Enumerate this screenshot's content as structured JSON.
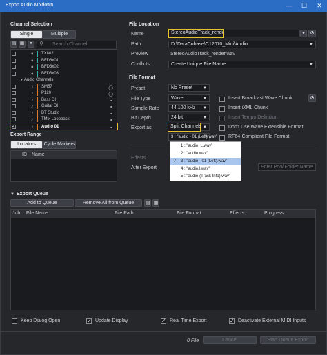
{
  "window": {
    "title": "Export Audio Mixdown",
    "minimize": "—",
    "maximize": "☐",
    "close": "✕"
  },
  "channel_selection": {
    "heading": "Channel Selection",
    "tabs": [
      {
        "label": "Single"
      },
      {
        "label": "Multiple"
      }
    ],
    "search_placeholder": "Search Channel",
    "tree_items": [
      {
        "name": "TX802",
        "color": "#2bb3a8",
        "checked": false,
        "type": "instrument"
      },
      {
        "name": "BFD3x01",
        "color": "#2bb3a8",
        "checked": false,
        "type": "instrument"
      },
      {
        "name": "BFD3x02",
        "color": "#2bb3a8",
        "checked": false,
        "type": "instrument"
      },
      {
        "name": "BFD3x03",
        "color": "#2bb3a8",
        "checked": false,
        "type": "instrument"
      },
      {
        "name": "Audio Channels",
        "color": "",
        "checked": false,
        "type": "group"
      },
      {
        "name": "SM57",
        "color": "#e07a2b",
        "checked": false,
        "type": "audio"
      },
      {
        "name": "P120",
        "color": "#e07a2b",
        "checked": false,
        "type": "audio"
      },
      {
        "name": "Bass DI",
        "color": "#e07a2b",
        "checked": false,
        "type": "audio"
      },
      {
        "name": "Guitar DI",
        "color": "#e07a2b",
        "checked": false,
        "type": "audio"
      },
      {
        "name": "BT Studio",
        "color": "#e07a2b",
        "checked": false,
        "type": "audio"
      },
      {
        "name": "TMix Loopback",
        "color": "#e07a2b",
        "checked": false,
        "type": "audio"
      },
      {
        "name": "Audio 01",
        "color": "#e07a2b",
        "checked": true,
        "type": "audio"
      }
    ]
  },
  "export_range": {
    "heading": "Export Range",
    "tabs": [
      {
        "label": "Locators"
      },
      {
        "label": "Cycle Markers"
      }
    ],
    "columns": [
      "ID",
      "Name"
    ]
  },
  "file_location": {
    "heading": "File Location",
    "name_label": "Name",
    "name_value": "StereoAudioTrack_render",
    "path_label": "Path",
    "path_value": "D:\\DataCubase\\C12070_Mini\\Audio",
    "preview_label": "Preview",
    "preview_value": "StereoAudioTrack_render.wav",
    "conflicts_label": "Conflicts",
    "conflicts_value": "Create Unique File Name"
  },
  "file_format": {
    "heading": "File Format",
    "preset_label": "Preset",
    "preset_value": "No Preset",
    "file_type_label": "File Type",
    "file_type_value": "Wave",
    "sample_rate_label": "Sample Rate",
    "sample_rate_value": "44.100 kHz",
    "bit_depth_label": "Bit Depth",
    "bit_depth_value": "24 bit",
    "export_as_label": "Export as",
    "export_as_value": "Split Channels",
    "channel_value": "3 : \"audio - 01 (Left).wav\"",
    "options": [
      {
        "label": "Insert Broadcast Wave Chunk",
        "checked": false,
        "disabled": false
      },
      {
        "label": "Insert iXML Chunk",
        "checked": false,
        "disabled": false
      },
      {
        "label": "Insert Tempo Definition",
        "checked": false,
        "disabled": true
      },
      {
        "label": "Don't Use Wave Extensible Format",
        "checked": false,
        "disabled": false
      },
      {
        "label": "RF64-Compliant File Format",
        "checked": false,
        "disabled": false
      }
    ],
    "channel_menu": [
      {
        "label": "1 : \"audio_L.wav\"",
        "selected": false
      },
      {
        "label": "2 : \"audio.wav\"",
        "selected": false
      },
      {
        "label": "3 : \"audio - 01 (Left).wav\"",
        "selected": true
      },
      {
        "label": "4 : \"audio.l.wav\"",
        "selected": false
      },
      {
        "label": "5 : \"audio-(Track Info).wav\"",
        "selected": false
      }
    ],
    "check_mark": "✓"
  },
  "effects": {
    "label": "Effects",
    "after_export_label": "After Export",
    "pool_placeholder": "Enter Pool Folder Name"
  },
  "export_queue": {
    "heading": "Export Queue",
    "add_label": "Add to Queue",
    "remove_label": "Remove All from Queue",
    "columns": [
      "Job",
      "File Name",
      "File Path",
      "File Format",
      "Effects",
      "Progress"
    ]
  },
  "footer": {
    "options": [
      {
        "label": "Keep Dialog Open",
        "checked": false
      },
      {
        "label": "Update Display",
        "checked": true
      },
      {
        "label": "Real Time Export",
        "checked": true
      },
      {
        "label": "Deactivate External MIDI Inputs",
        "checked": true
      }
    ],
    "file_count": "0 File",
    "cancel_label": "Cancel",
    "start_label": "Start Queue Export"
  }
}
